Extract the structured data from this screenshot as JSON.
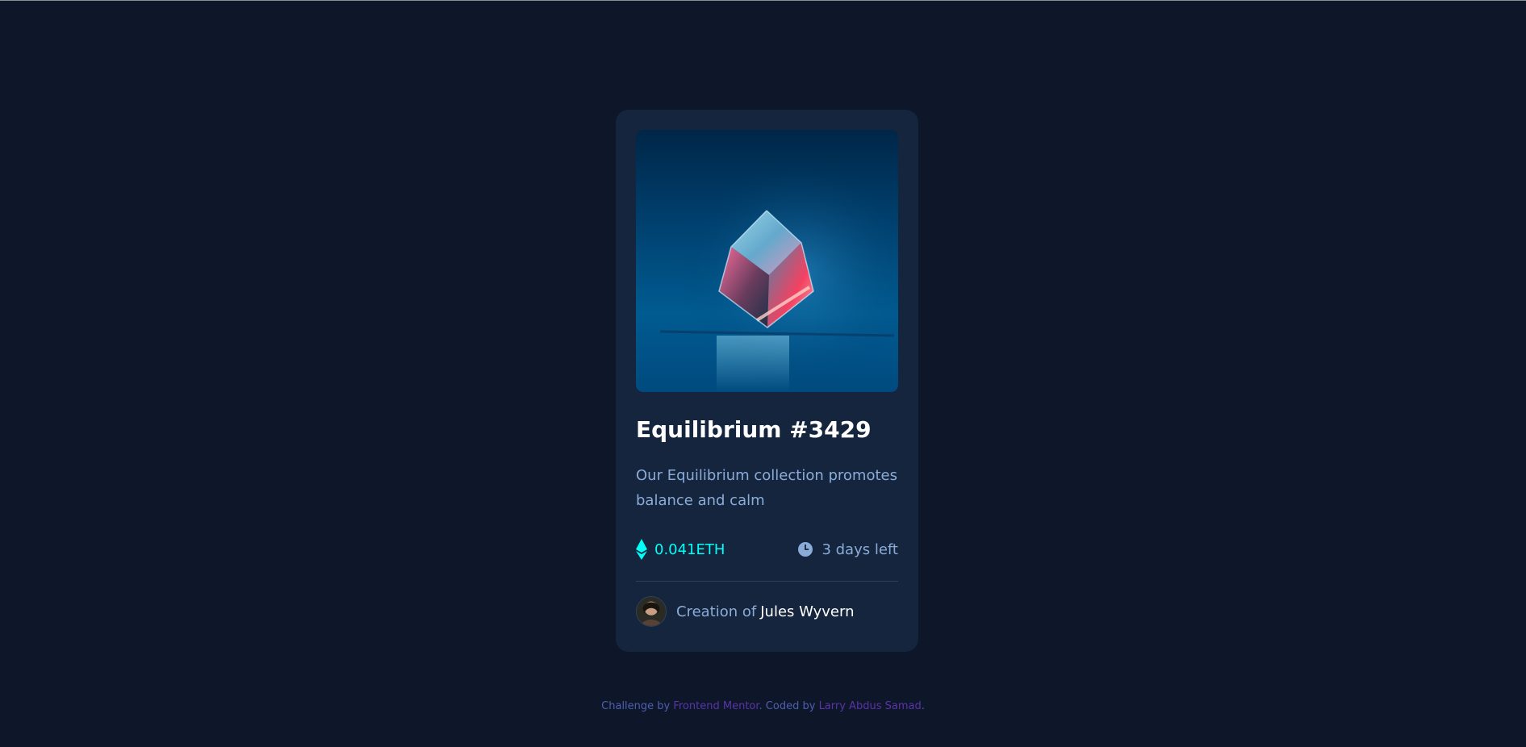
{
  "card": {
    "image_alt": "Equilibrium cube",
    "title": "Equilibrium #3429",
    "description": "Our Equilibrium collection promotes balance and calm",
    "price": "0.041ETH",
    "time_left": "3 days left",
    "creator_prefix": "Creation of",
    "creator_name": "Jules Wyvern",
    "icons": {
      "price": "ethereum-icon",
      "time": "clock-icon"
    }
  },
  "footer": {
    "prefix": "Challenge by",
    "challenge_link": "Frontend Mentor",
    "middle": ". Coded by",
    "author_link": "Larry Abdus Samad",
    "suffix": "."
  },
  "colors": {
    "background": "#0d1729",
    "card": "#14253d",
    "accent_cyan": "#00fff8",
    "soft_blue": "#8bacd9",
    "white": "#ffffff",
    "link_purple": "#5a34a8"
  }
}
